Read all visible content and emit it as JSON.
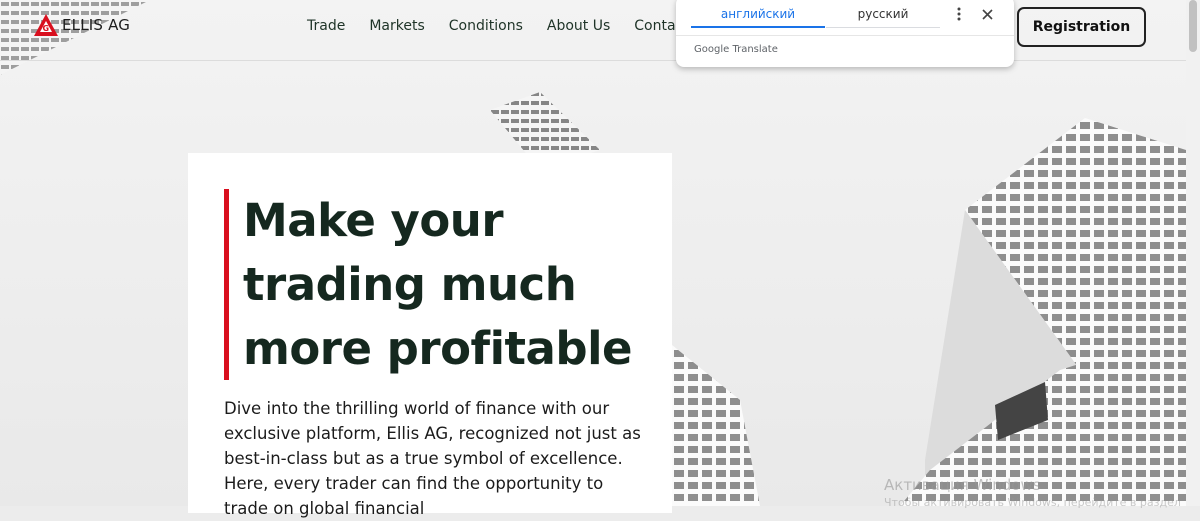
{
  "brand": {
    "name": "ELLIS AG",
    "logo_mark_color": "#d90f1e"
  },
  "nav": {
    "items": [
      {
        "label": "Trade"
      },
      {
        "label": "Markets"
      },
      {
        "label": "Conditions"
      },
      {
        "label": "About Us"
      },
      {
        "label": "Contac"
      }
    ],
    "registration_label": "Registration"
  },
  "translate_popup": {
    "tabs": [
      {
        "label": "английский",
        "active": true
      },
      {
        "label": "русский",
        "active": false
      }
    ],
    "brand_google": "Google",
    "brand_translate": "Translate",
    "more_icon": "more-vert-icon",
    "close_icon": "close-icon"
  },
  "hero": {
    "title": "Make your trading much more profitable",
    "text": "Dive into the thrilling world of finance with our exclusive platform, Ellis AG, recognized not just as best-in-class but as a true symbol of excellence. Here, every trader can find the opportunity to trade on global financial",
    "accent_color": "#d90f1e",
    "title_color": "#15281f"
  },
  "os_watermark": {
    "title": "Активация Windows",
    "subtitle": "Чтобы активировать Windows, перейдите в раздел"
  }
}
